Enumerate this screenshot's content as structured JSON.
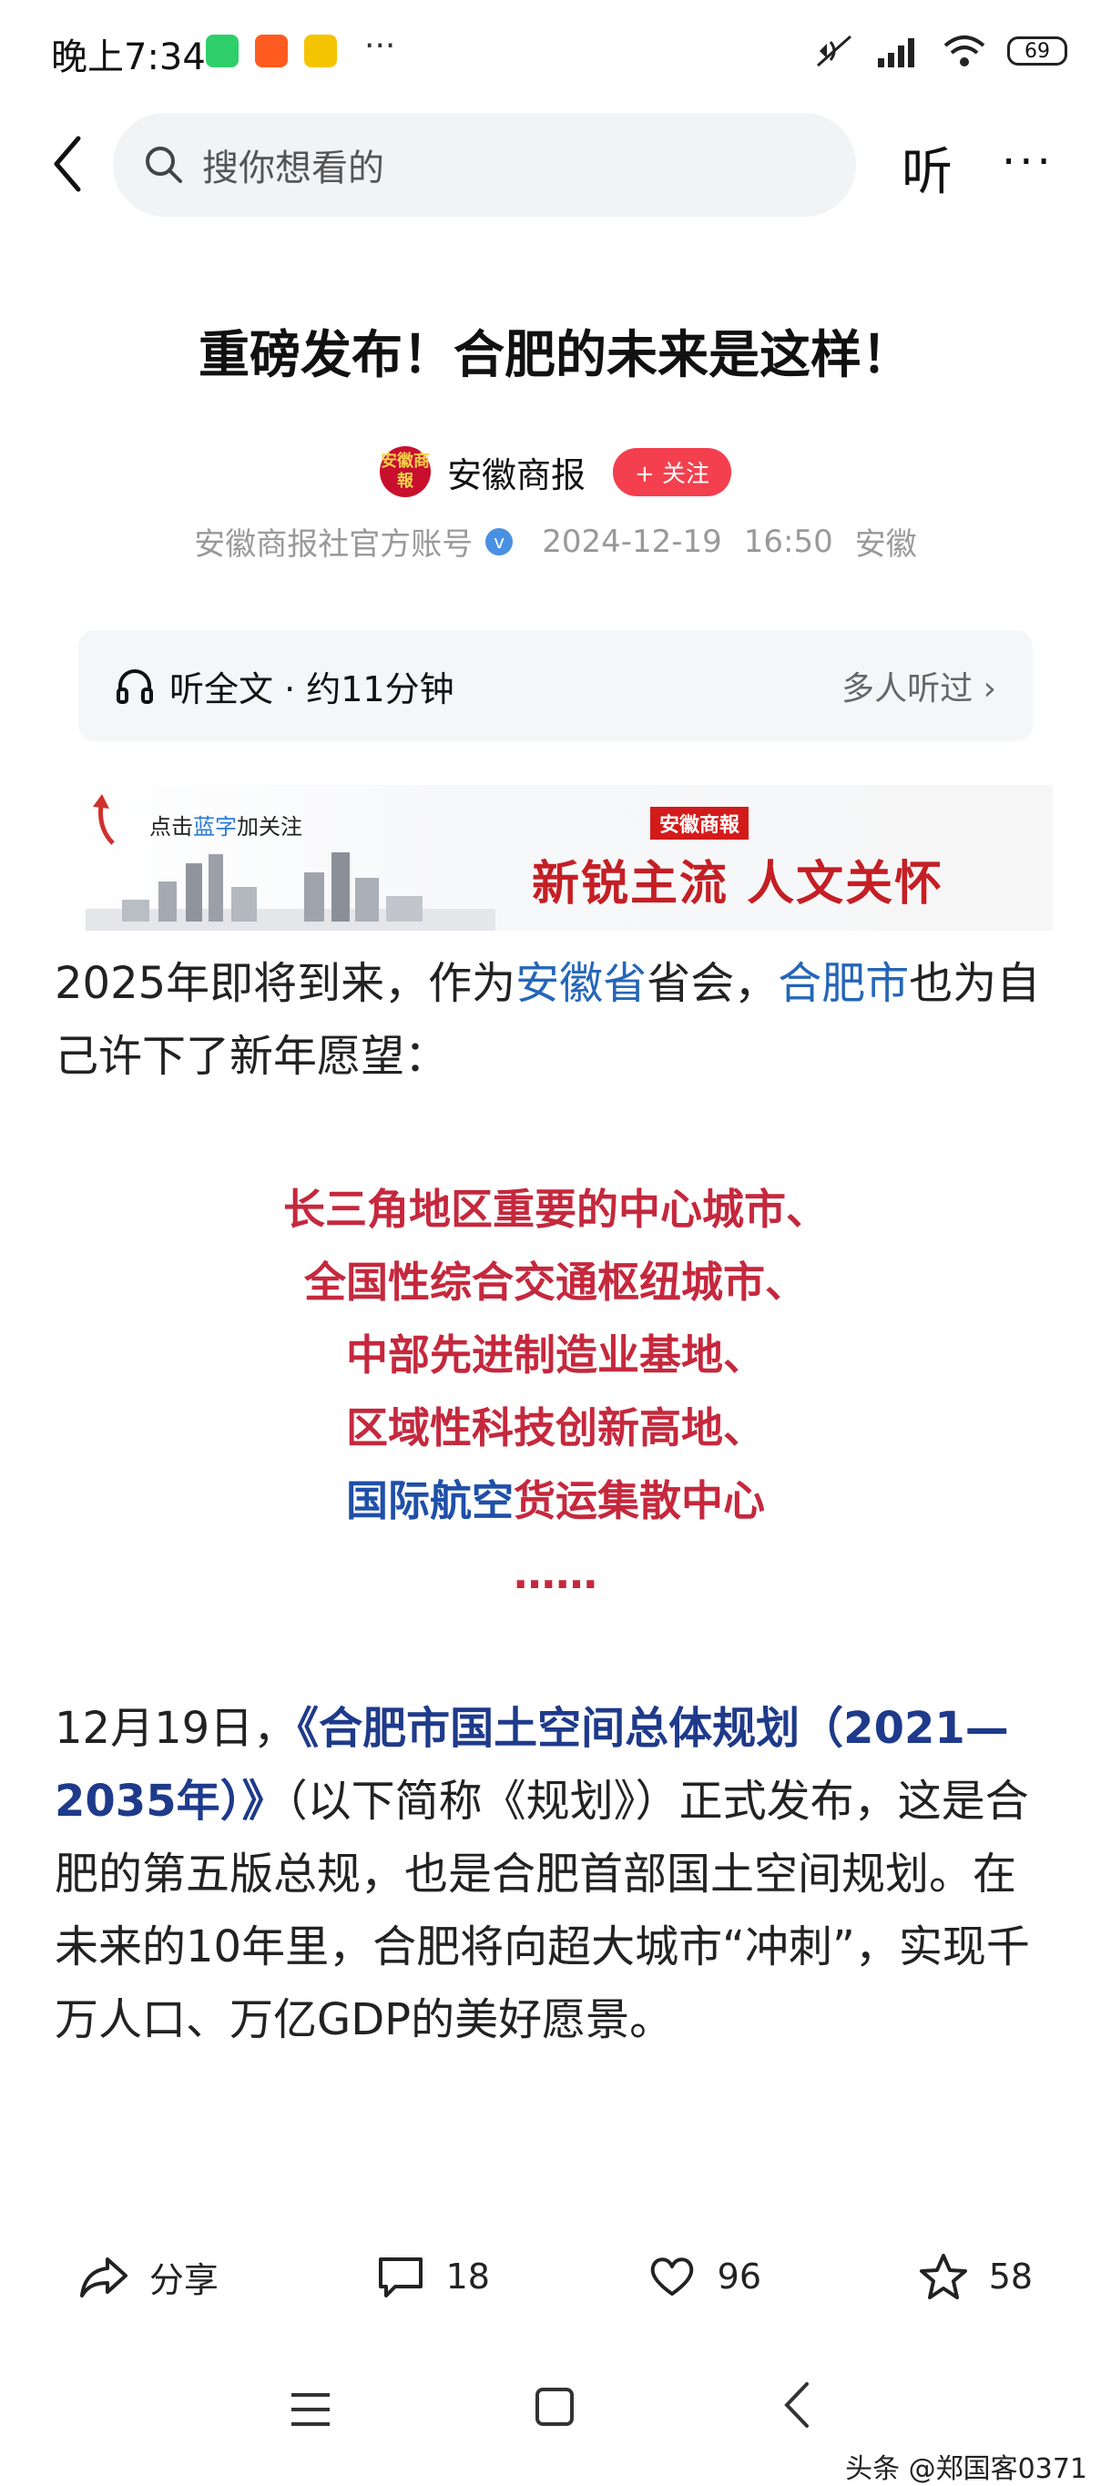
{
  "status_bar": {
    "time": "晚上7:34",
    "apps": [
      "wechat-icon",
      "taobao-icon",
      "guoguo-icon"
    ],
    "more": "···",
    "battery": "69"
  },
  "nav": {
    "search_placeholder": "搜你想看的",
    "listen": "听",
    "more": "···"
  },
  "article": {
    "title": "重磅发布！合肥的未来是这样！",
    "author": "安徽商报",
    "author_logo": "安徽商報",
    "follow": "+ 关注",
    "account": "安徽商报社官方账号",
    "date": "2024-12-19",
    "time": "16:50",
    "location": "安徽"
  },
  "listen_bar": {
    "label": "听全文 · 约11分钟",
    "right": "多人听过 ›"
  },
  "banner": {
    "follow_prefix": "点击",
    "follow_blue": "蓝字",
    "follow_suffix": "加关注",
    "logo": "安徽商報",
    "slogan": "新锐主流   人文关怀"
  },
  "para1": {
    "a": "2025年即将到来，作为",
    "link1": "安徽省",
    "b": "省会，",
    "link2": "合肥市",
    "c": "也为自己许下了新年愿望："
  },
  "wishes": [
    "长三角地区重要的中心城市、",
    "全国性综合交通枢纽城市、",
    "中部先进制造业基地、",
    "区域性科技创新高地、"
  ],
  "wish_last_navy": "国际航空",
  "wish_last_red": "货运集散中心",
  "ellipsis": "……",
  "para2": {
    "a": "12月19日，",
    "plan": "《合肥市国土空间总体规划（2021—2035年）》",
    "b": "（以下简称《规划》）正式发布，这是合肥的第五版总规，也是合肥首部国土空间规划。在未来的10年里，合肥将向超大城市“冲刺”，实现千万人口、万亿GDP的美好愿景。"
  },
  "actions": {
    "share": "分享",
    "comments": "18",
    "likes": "96",
    "favorites": "58"
  },
  "watermark": "头条 @郑国客0371"
}
